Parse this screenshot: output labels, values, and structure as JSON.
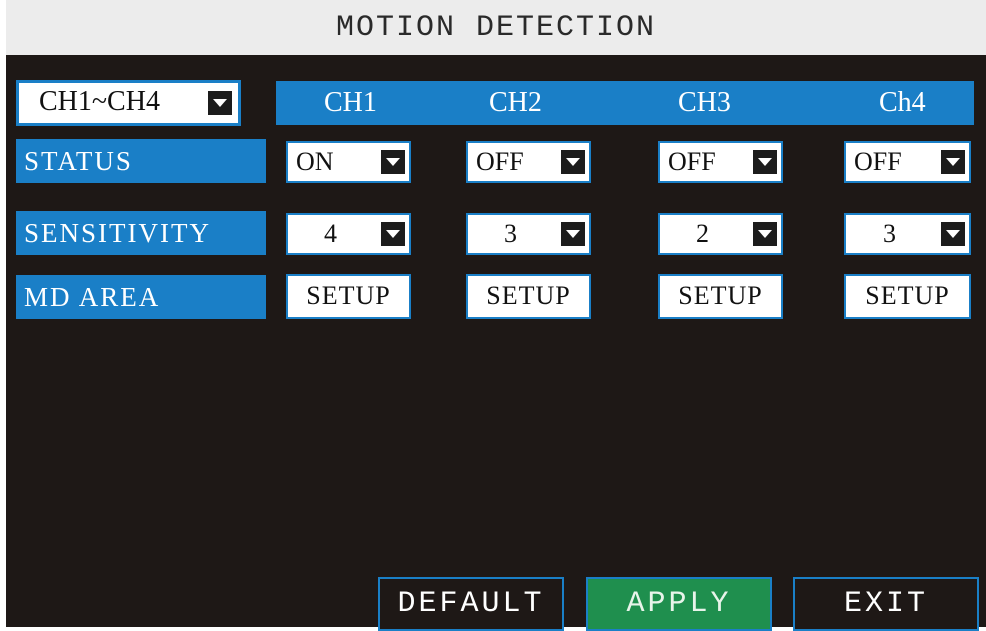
{
  "title": "MOTION DETECTION",
  "channel_selector": {
    "value": "CH1~CH4"
  },
  "channels": [
    "CH1",
    "CH2",
    "CH3",
    "Ch4"
  ],
  "rows": {
    "status": {
      "label": "STATUS",
      "values": [
        "ON",
        "OFF",
        "OFF",
        "OFF"
      ]
    },
    "sensitivity": {
      "label": "SENSITIVITY",
      "values": [
        "4",
        "3",
        "2",
        "3"
      ]
    },
    "md_area": {
      "label": "MD AREA",
      "values": [
        "SETUP",
        "SETUP",
        "SETUP",
        "SETUP"
      ]
    }
  },
  "buttons": {
    "default": "DEFAULT",
    "apply": "APPLY",
    "exit": "EXIT"
  },
  "colors": {
    "accent": "#1a7fc7",
    "apply": "#1f8f4e",
    "background": "#1e1816"
  }
}
